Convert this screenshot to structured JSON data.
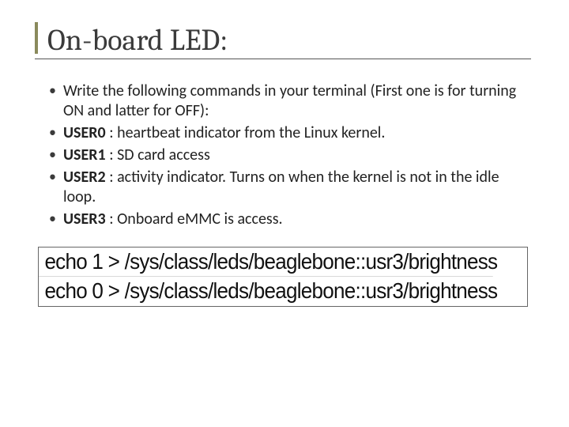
{
  "title": "On-board LED:",
  "bullets": {
    "b0": "Write the following commands in your terminal (First one is for turning ON and latter for OFF):",
    "b1_label": "USER0",
    "b1_text": " : heartbeat indicator from the Linux kernel.",
    "b2_label": "USER1",
    "b2_text": " : SD card access",
    "b3_label": "USER2",
    "b3_text": " : activity indicator. Turns on when the kernel is not in the idle loop.",
    "b4_label": "USER3",
    "b4_text": " : Onboard eMMC is access."
  },
  "commands": {
    "c0": "echo 1 > /sys/class/leds/beaglebone::usr3/brightness",
    "c1": "echo 0 > /sys/class/leds/beaglebone::usr3/brightness"
  }
}
